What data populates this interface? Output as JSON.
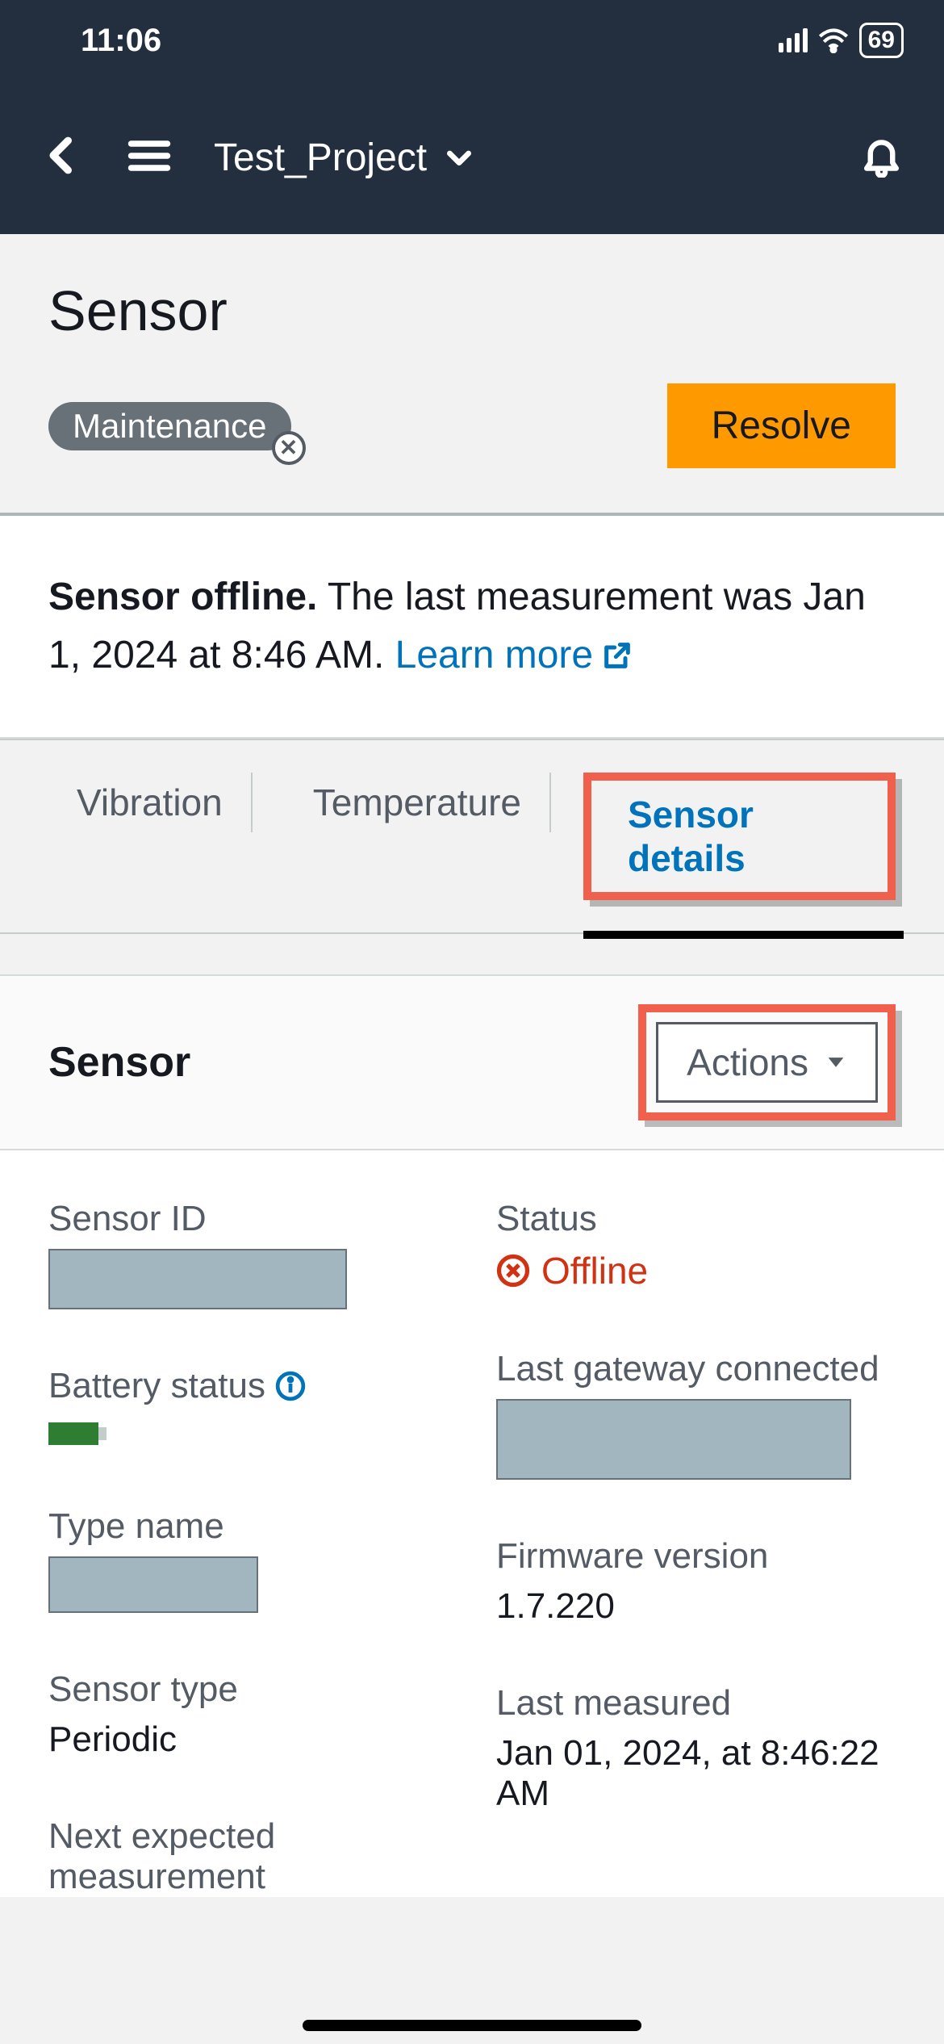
{
  "status_bar": {
    "time": "11:06",
    "battery_pct": "69"
  },
  "header": {
    "project_name": "Test_Project"
  },
  "page": {
    "title": "Sensor",
    "tag": "Maintenance",
    "resolve_btn": "Resolve"
  },
  "alert": {
    "heading": "Sensor offline.",
    "body": "The last measurement was Jan 1, 2024 at 8:46 AM.",
    "link_text": "Learn more"
  },
  "tabs": {
    "vibration": "Vibration",
    "temperature": "Temperature",
    "sensor_details": "Sensor details"
  },
  "section": {
    "title": "Sensor",
    "actions_btn": "Actions"
  },
  "details": {
    "left": {
      "sensor_id_label": "Sensor ID",
      "battery_status_label": "Battery status",
      "type_name_label": "Type name",
      "sensor_type_label": "Sensor type",
      "sensor_type_value": "Periodic",
      "next_expected_label": "Next expected measurement"
    },
    "right": {
      "status_label": "Status",
      "status_value": "Offline",
      "last_gateway_label": "Last gateway connected",
      "firmware_label": "Firmware version",
      "firmware_value": "1.7.220",
      "last_measured_label": "Last measured",
      "last_measured_value": "Jan 01, 2024, at 8:46:22 AM"
    }
  }
}
